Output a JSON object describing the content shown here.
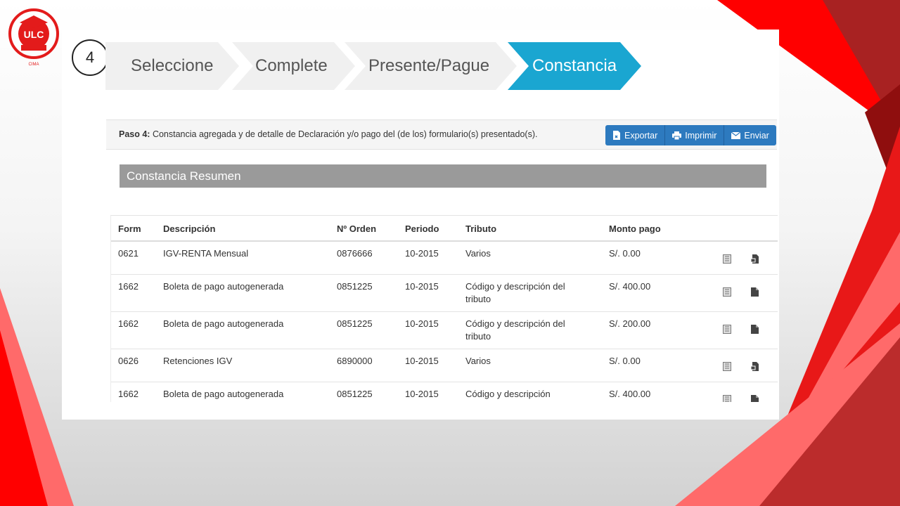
{
  "logo": {
    "text": "ULC",
    "arc_text": "UNIVERSIDAD LATINOAMERICANA",
    "bottom_text": "CIMA"
  },
  "step_number": "4",
  "wizard": {
    "steps": [
      "Seleccione",
      "Complete",
      "Presente/Pague",
      "Constancia"
    ],
    "active_index": 3,
    "active_color": "#1aa6d1"
  },
  "paso": {
    "label": "Paso 4:",
    "text": " Constancia agregada y de detalle de Declaración y/o pago del (de los) formulario(s) presentado(s)."
  },
  "buttons": {
    "exportar": "Exportar",
    "imprimir": "Imprimir",
    "enviar": "Enviar"
  },
  "resumen_title": "Constancia Resumen",
  "table": {
    "headers": {
      "form": "Form",
      "descripcion": "Descripción",
      "orden": "Nº Orden",
      "periodo": "Periodo",
      "tributo": "Tributo",
      "monto": "Monto pago"
    },
    "rows": [
      {
        "form": "0621",
        "descripcion": "IGV-RENTA Mensual",
        "orden": "0876666",
        "periodo": "10-2015",
        "tributo": "Varios",
        "monto": "S/. 0.00"
      },
      {
        "form": "1662",
        "descripcion": "Boleta de pago autogenerada",
        "orden": "0851225",
        "periodo": "10-2015",
        "tributo": "Código y descripción del tributo",
        "monto": "S/. 400.00"
      },
      {
        "form": "1662",
        "descripcion": "Boleta de pago autogenerada",
        "orden": "0851225",
        "periodo": "10-2015",
        "tributo": "Código y descripción del tributo",
        "monto": "S/. 200.00"
      },
      {
        "form": "0626",
        "descripcion": "Retenciones IGV",
        "orden": "6890000",
        "periodo": "10-2015",
        "tributo": "Varios",
        "monto": "S/. 0.00"
      },
      {
        "form": "1662",
        "descripcion": "Boleta de pago autogenerada",
        "orden": "0851225",
        "periodo": "10-2015",
        "tributo": "Código y descripción",
        "monto": "S/. 400.00"
      }
    ]
  },
  "colors": {
    "brand_red": "#ee1c1c",
    "button_blue": "#2d7abf",
    "header_gray": "#9a9a9a"
  }
}
